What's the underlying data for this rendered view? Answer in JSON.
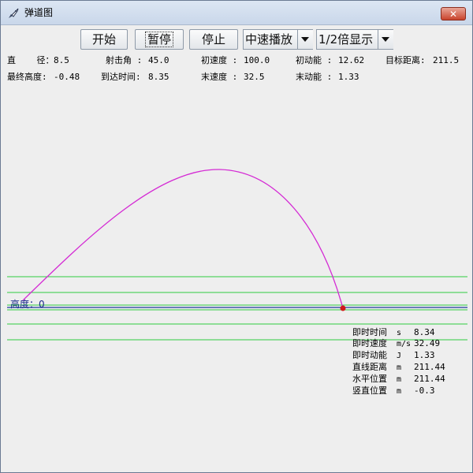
{
  "window": {
    "title": "弹道图",
    "close_icon": "close-icon"
  },
  "toolbar": {
    "start_label": "开始",
    "pause_label": "暂停",
    "stop_label": "停止",
    "speed_value": "中速播放",
    "scale_value": "1/2倍显示"
  },
  "params": {
    "diameter_label": "直    径：",
    "diameter_value": "8.5",
    "angle_label": "射击角 :",
    "angle_value": "45.0",
    "init_speed_label": "初速度 :",
    "init_speed_value": "100.0",
    "init_energy_label": "初动能 :",
    "init_energy_value": "12.62",
    "target_dist_label": "目标距离:",
    "target_dist_value": "211.5",
    "final_height_label": "最终高度:",
    "final_height_value": "-0.48",
    "arrival_time_label": "到达时间:",
    "arrival_time_value": "8.35",
    "end_speed_label": "末速度 :",
    "end_speed_value": "32.5",
    "end_energy_label": "末动能 :",
    "end_energy_value": "1.33"
  },
  "plot": {
    "height_label": "高度：",
    "height_value": "0",
    "trajectory_color": "#d42ad4",
    "guide_color": "#2ecc40",
    "ground_color": "#1a3a9c",
    "projectile_color": "#d01a1a"
  },
  "readout": [
    {
      "label": "即时时间",
      "unit": "s",
      "value": "8.34"
    },
    {
      "label": "即时速度",
      "unit": "m/s",
      "value": "32.49"
    },
    {
      "label": "即时动能",
      "unit": "J",
      "value": "1.33"
    },
    {
      "label": "直线距离",
      "unit": "m",
      "value": "211.44"
    },
    {
      "label": "水平位置",
      "unit": "m",
      "value": "211.44"
    },
    {
      "label": "竖直位置",
      "unit": "m",
      "value": "-0.3"
    }
  ]
}
